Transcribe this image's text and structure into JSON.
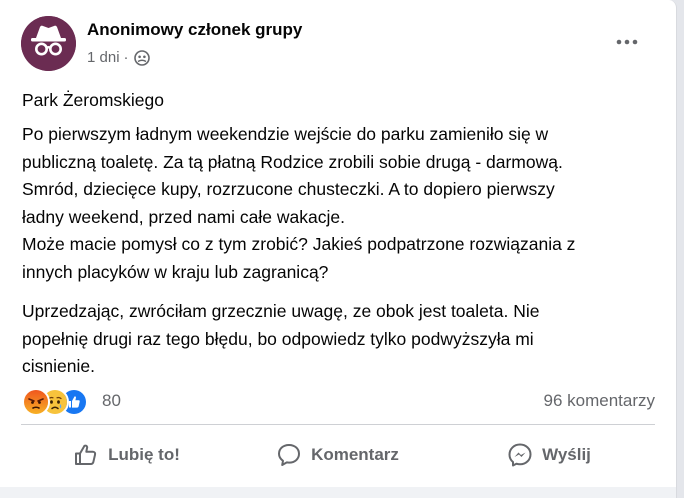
{
  "post": {
    "author": "Anonimowy członek grupy",
    "time": "1 dni",
    "separator": "·",
    "audience_icon": "group-icon",
    "title": "Park Żeromskiego",
    "paragraph1": [
      "Po pierwszym ładnym weekendzie wejście do parku zamieniło się w",
      "publiczną toaletę. Za tą płatną Rodzice zrobili sobie drugą - darmową.",
      "Smród, dziecięce kupy, rozrzucone chusteczki. A to dopiero pierwszy",
      "ładny weekend, przed nami całe wakacje.",
      "Może macie pomysł co z tym zrobić? Jakieś podpatrzone rozwiązania z",
      "innych placyków w kraju lub zagranicą?"
    ],
    "paragraph2": [
      "Uprzedzając, zwróciłam grzecznie uwagę, ze obok jest toaleta. Nie",
      "popełnię drugi raz tego błędu, bo odpowiedz tylko podwyższyła mi",
      "cisnienie."
    ]
  },
  "reactions": {
    "icons": [
      "angry-reaction-icon",
      "sad-reaction-icon",
      "like-reaction-icon"
    ],
    "count": "80",
    "comments": "96 komentarzy"
  },
  "actions": {
    "like": "Lubię to!",
    "comment": "Komentarz",
    "share": "Wyślij"
  },
  "colors": {
    "avatar_bg": "#6b2c52",
    "secondary_text": "#65676b",
    "like_blue": "#1877f2",
    "angry_orange": "#e9710f",
    "sad_yellow": "#f7b125"
  }
}
